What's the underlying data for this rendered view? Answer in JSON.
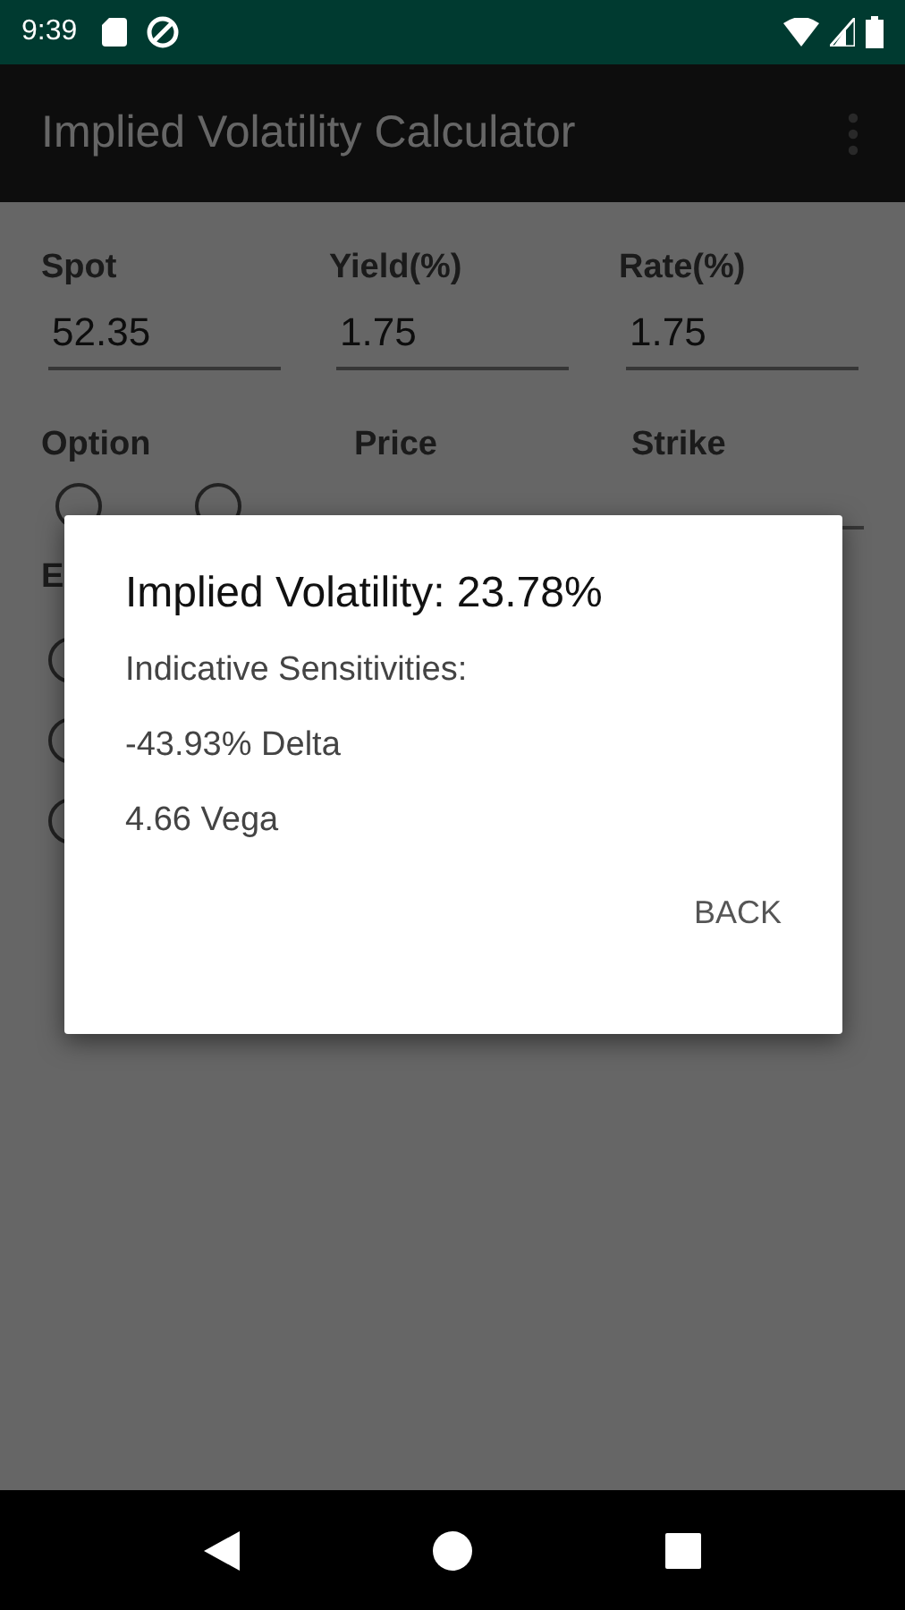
{
  "status_bar": {
    "time": "9:39"
  },
  "app_bar": {
    "title": "Implied Volatility Calculator"
  },
  "inputs": [
    {
      "label": "Spot",
      "value": "52.35"
    },
    {
      "label": "Yield(%)",
      "value": "1.75"
    },
    {
      "label": "Rate(%)",
      "value": "1.75"
    }
  ],
  "second_row_labels": [
    "Option",
    "Price",
    "Strike"
  ],
  "partial_label": "E",
  "dialog": {
    "title": "Implied Volatility: 23.78%",
    "subtitle": "Indicative Sensitivities:",
    "lines": [
      "-43.93% Delta",
      "4.66 Vega"
    ],
    "button": "BACK"
  }
}
